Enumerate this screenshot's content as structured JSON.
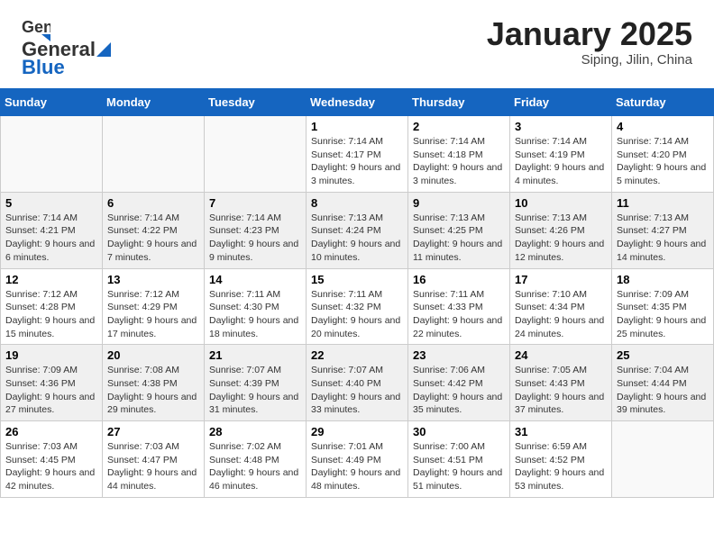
{
  "header": {
    "logo_general": "General",
    "logo_blue": "Blue",
    "month_title": "January 2025",
    "subtitle": "Siping, Jilin, China"
  },
  "weekdays": [
    "Sunday",
    "Monday",
    "Tuesday",
    "Wednesday",
    "Thursday",
    "Friday",
    "Saturday"
  ],
  "weeks": [
    [
      {
        "day": "",
        "info": ""
      },
      {
        "day": "",
        "info": ""
      },
      {
        "day": "",
        "info": ""
      },
      {
        "day": "1",
        "info": "Sunrise: 7:14 AM\nSunset: 4:17 PM\nDaylight: 9 hours and 3 minutes."
      },
      {
        "day": "2",
        "info": "Sunrise: 7:14 AM\nSunset: 4:18 PM\nDaylight: 9 hours and 3 minutes."
      },
      {
        "day": "3",
        "info": "Sunrise: 7:14 AM\nSunset: 4:19 PM\nDaylight: 9 hours and 4 minutes."
      },
      {
        "day": "4",
        "info": "Sunrise: 7:14 AM\nSunset: 4:20 PM\nDaylight: 9 hours and 5 minutes."
      }
    ],
    [
      {
        "day": "5",
        "info": "Sunrise: 7:14 AM\nSunset: 4:21 PM\nDaylight: 9 hours and 6 minutes."
      },
      {
        "day": "6",
        "info": "Sunrise: 7:14 AM\nSunset: 4:22 PM\nDaylight: 9 hours and 7 minutes."
      },
      {
        "day": "7",
        "info": "Sunrise: 7:14 AM\nSunset: 4:23 PM\nDaylight: 9 hours and 9 minutes."
      },
      {
        "day": "8",
        "info": "Sunrise: 7:13 AM\nSunset: 4:24 PM\nDaylight: 9 hours and 10 minutes."
      },
      {
        "day": "9",
        "info": "Sunrise: 7:13 AM\nSunset: 4:25 PM\nDaylight: 9 hours and 11 minutes."
      },
      {
        "day": "10",
        "info": "Sunrise: 7:13 AM\nSunset: 4:26 PM\nDaylight: 9 hours and 12 minutes."
      },
      {
        "day": "11",
        "info": "Sunrise: 7:13 AM\nSunset: 4:27 PM\nDaylight: 9 hours and 14 minutes."
      }
    ],
    [
      {
        "day": "12",
        "info": "Sunrise: 7:12 AM\nSunset: 4:28 PM\nDaylight: 9 hours and 15 minutes."
      },
      {
        "day": "13",
        "info": "Sunrise: 7:12 AM\nSunset: 4:29 PM\nDaylight: 9 hours and 17 minutes."
      },
      {
        "day": "14",
        "info": "Sunrise: 7:11 AM\nSunset: 4:30 PM\nDaylight: 9 hours and 18 minutes."
      },
      {
        "day": "15",
        "info": "Sunrise: 7:11 AM\nSunset: 4:32 PM\nDaylight: 9 hours and 20 minutes."
      },
      {
        "day": "16",
        "info": "Sunrise: 7:11 AM\nSunset: 4:33 PM\nDaylight: 9 hours and 22 minutes."
      },
      {
        "day": "17",
        "info": "Sunrise: 7:10 AM\nSunset: 4:34 PM\nDaylight: 9 hours and 24 minutes."
      },
      {
        "day": "18",
        "info": "Sunrise: 7:09 AM\nSunset: 4:35 PM\nDaylight: 9 hours and 25 minutes."
      }
    ],
    [
      {
        "day": "19",
        "info": "Sunrise: 7:09 AM\nSunset: 4:36 PM\nDaylight: 9 hours and 27 minutes."
      },
      {
        "day": "20",
        "info": "Sunrise: 7:08 AM\nSunset: 4:38 PM\nDaylight: 9 hours and 29 minutes."
      },
      {
        "day": "21",
        "info": "Sunrise: 7:07 AM\nSunset: 4:39 PM\nDaylight: 9 hours and 31 minutes."
      },
      {
        "day": "22",
        "info": "Sunrise: 7:07 AM\nSunset: 4:40 PM\nDaylight: 9 hours and 33 minutes."
      },
      {
        "day": "23",
        "info": "Sunrise: 7:06 AM\nSunset: 4:42 PM\nDaylight: 9 hours and 35 minutes."
      },
      {
        "day": "24",
        "info": "Sunrise: 7:05 AM\nSunset: 4:43 PM\nDaylight: 9 hours and 37 minutes."
      },
      {
        "day": "25",
        "info": "Sunrise: 7:04 AM\nSunset: 4:44 PM\nDaylight: 9 hours and 39 minutes."
      }
    ],
    [
      {
        "day": "26",
        "info": "Sunrise: 7:03 AM\nSunset: 4:45 PM\nDaylight: 9 hours and 42 minutes."
      },
      {
        "day": "27",
        "info": "Sunrise: 7:03 AM\nSunset: 4:47 PM\nDaylight: 9 hours and 44 minutes."
      },
      {
        "day": "28",
        "info": "Sunrise: 7:02 AM\nSunset: 4:48 PM\nDaylight: 9 hours and 46 minutes."
      },
      {
        "day": "29",
        "info": "Sunrise: 7:01 AM\nSunset: 4:49 PM\nDaylight: 9 hours and 48 minutes."
      },
      {
        "day": "30",
        "info": "Sunrise: 7:00 AM\nSunset: 4:51 PM\nDaylight: 9 hours and 51 minutes."
      },
      {
        "day": "31",
        "info": "Sunrise: 6:59 AM\nSunset: 4:52 PM\nDaylight: 9 hours and 53 minutes."
      },
      {
        "day": "",
        "info": ""
      }
    ]
  ]
}
